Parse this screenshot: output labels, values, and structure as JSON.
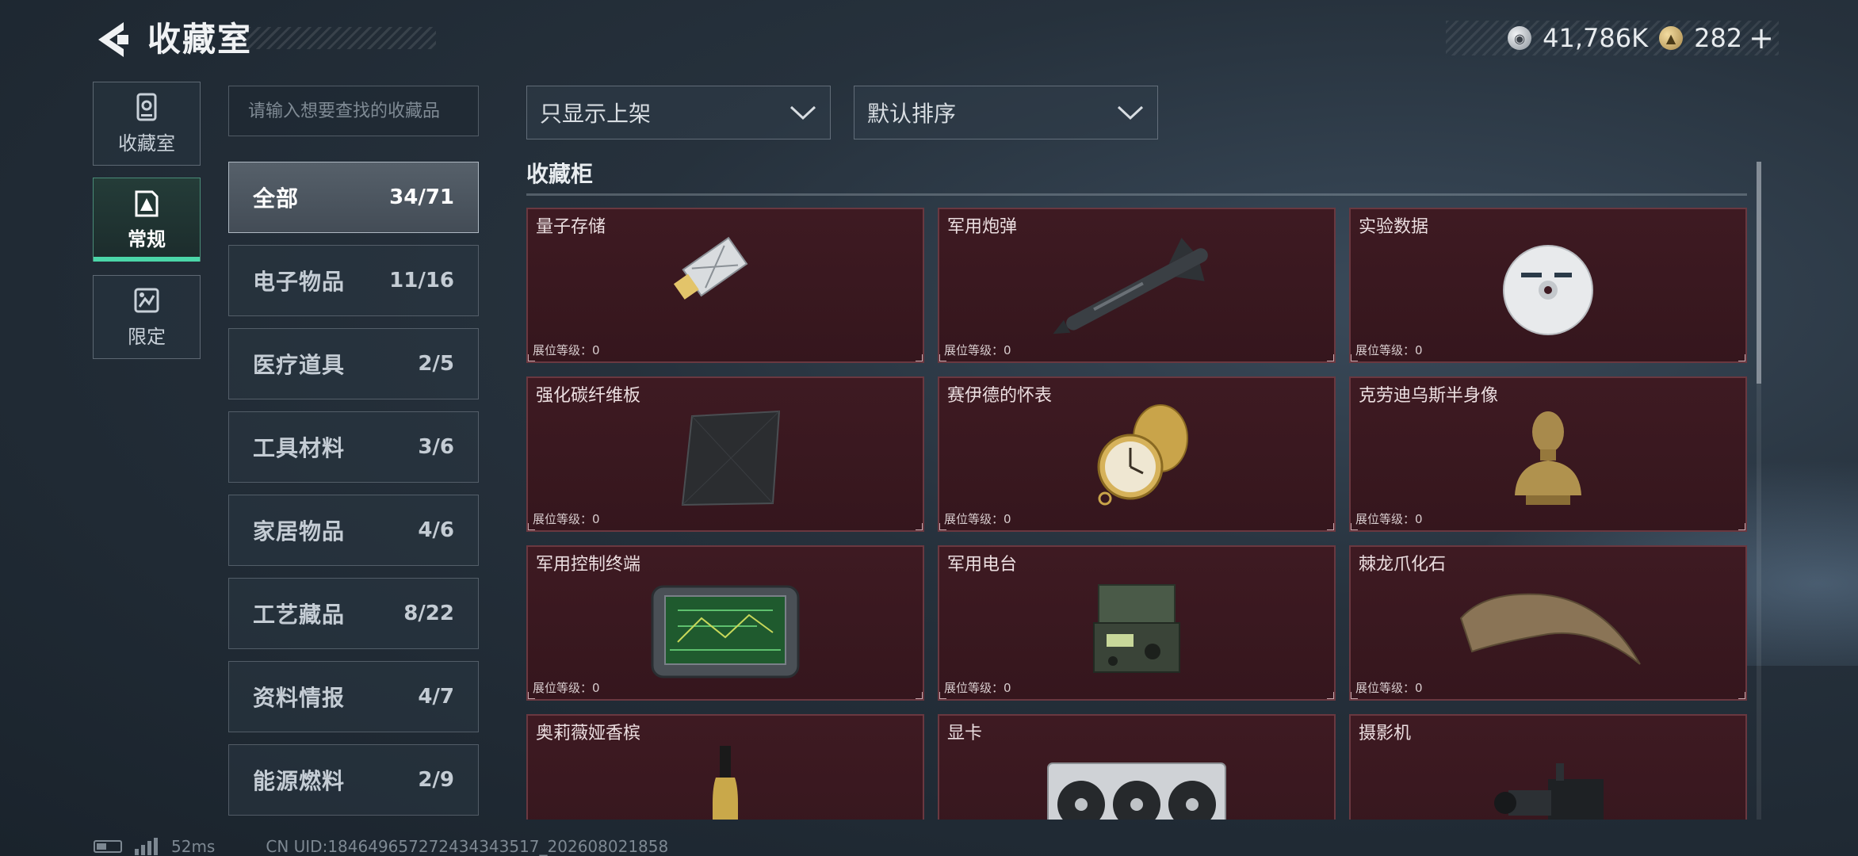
{
  "header": {
    "title": "收藏室",
    "back_icon": "back-arrow-icon",
    "currency": [
      {
        "icon": "silver-coin-icon",
        "value": "41,786K"
      },
      {
        "icon": "gold-coin-icon",
        "value": "282"
      }
    ],
    "add_symbol": "+"
  },
  "side_tabs": [
    {
      "label": "收藏室",
      "icon": "collection-room-icon",
      "active": false
    },
    {
      "label": "常规",
      "icon": "regular-icon",
      "active": true
    },
    {
      "label": "限定",
      "icon": "limited-icon",
      "active": false
    }
  ],
  "search": {
    "placeholder": "请输入想要查找的收藏品",
    "value": ""
  },
  "categories": [
    {
      "name": "全部",
      "count": "34/71",
      "active": true
    },
    {
      "name": "电子物品",
      "count": "11/16"
    },
    {
      "name": "医疗道具",
      "count": "2/5"
    },
    {
      "name": "工具材料",
      "count": "3/6"
    },
    {
      "name": "家居物品",
      "count": "4/6"
    },
    {
      "name": "工艺藏品",
      "count": "8/22"
    },
    {
      "name": "资料情报",
      "count": "4/7"
    },
    {
      "name": "能源燃料",
      "count": "2/9"
    }
  ],
  "filters": {
    "display": {
      "selected": "只显示上架"
    },
    "sort": {
      "selected": "默认排序"
    }
  },
  "section": {
    "title": "收藏柜"
  },
  "items": [
    {
      "name": "量子存储",
      "level_label": "展位等级：",
      "level": "0"
    },
    {
      "name": "军用炮弹",
      "level_label": "展位等级：",
      "level": "0"
    },
    {
      "name": "实验数据",
      "level_label": "展位等级：",
      "level": "0"
    },
    {
      "name": "强化碳纤维板",
      "level_label": "展位等级：",
      "level": "0"
    },
    {
      "name": "赛伊德的怀表",
      "level_label": "展位等级：",
      "level": "0"
    },
    {
      "name": "克劳迪乌斯半身像",
      "level_label": "展位等级：",
      "level": "0"
    },
    {
      "name": "军用控制终端",
      "level_label": "展位等级：",
      "level": "0"
    },
    {
      "name": "军用电台",
      "level_label": "展位等级：",
      "level": "0"
    },
    {
      "name": "棘龙爪化石",
      "level_label": "展位等级：",
      "level": "0"
    },
    {
      "name": "奥莉薇娅香槟",
      "level_label": "",
      "level": ""
    },
    {
      "name": "显卡",
      "level_label": "",
      "level": ""
    },
    {
      "name": "摄影机",
      "level_label": "",
      "level": ""
    }
  ],
  "status_bar": {
    "ping": "52ms",
    "uid": "CN UID:1846496572724343435​17_202608021858"
  },
  "colors": {
    "accent": "#4bd6a8",
    "card_bg": "#3e1a22",
    "card_border": "#6a3840"
  }
}
